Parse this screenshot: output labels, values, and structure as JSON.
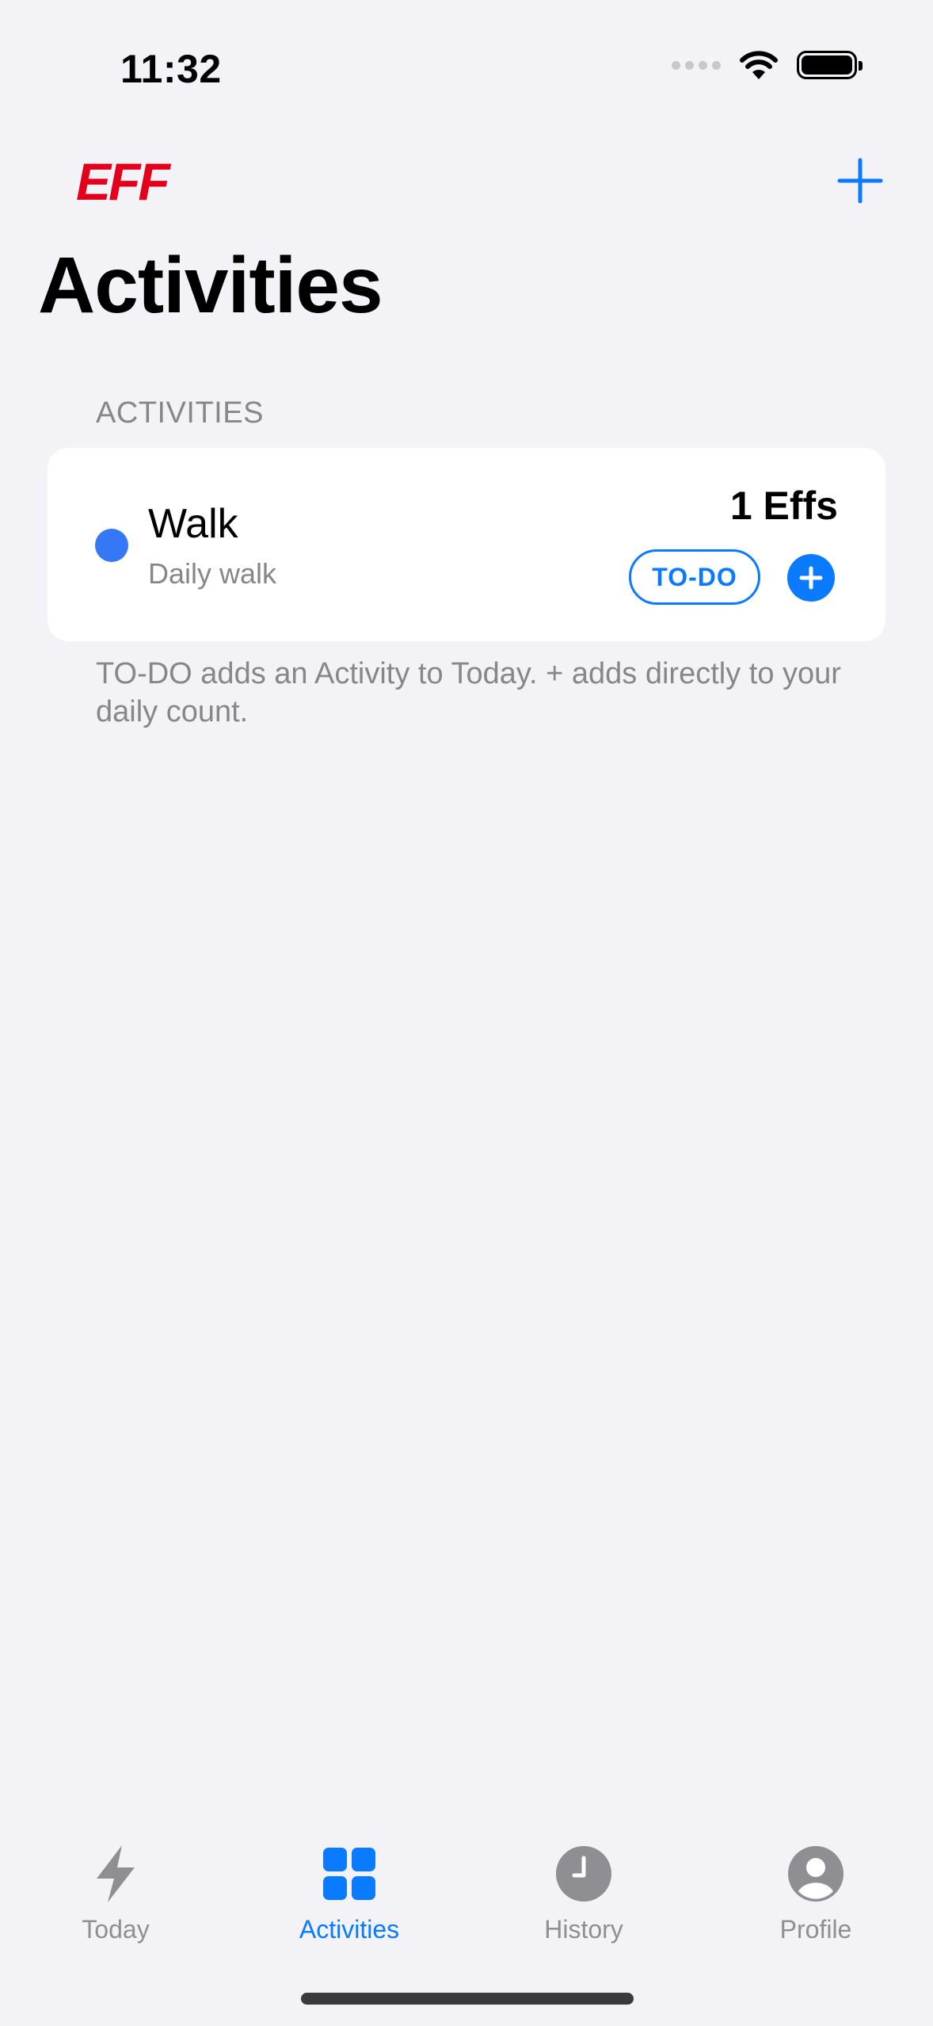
{
  "status_bar": {
    "time": "11:32"
  },
  "nav": {
    "logo_text": "EFF",
    "add_icon": "plus-icon"
  },
  "page": {
    "title": "Activities"
  },
  "activities_section": {
    "header": "ACTIVITIES",
    "items": [
      {
        "title": "Walk",
        "subtitle": "Daily walk",
        "count_label": "1 Effs",
        "dot_color": "#3478f6",
        "todo_label": "TO-DO"
      }
    ],
    "footer": "TO-DO adds an Activity to Today. + adds directly to your daily count."
  },
  "tab_bar": {
    "items": [
      {
        "label": "Today",
        "icon": "bolt-icon",
        "active": false
      },
      {
        "label": "Activities",
        "icon": "grid-icon",
        "active": true
      },
      {
        "label": "History",
        "icon": "clock-icon",
        "active": false
      },
      {
        "label": "Profile",
        "icon": "person-icon",
        "active": false
      }
    ]
  },
  "colors": {
    "accent": "#0a7aff",
    "brand": "#e4001b",
    "background": "#f2f2f7",
    "secondary_text": "#86868b",
    "inactive_tab": "#8e8e93"
  }
}
